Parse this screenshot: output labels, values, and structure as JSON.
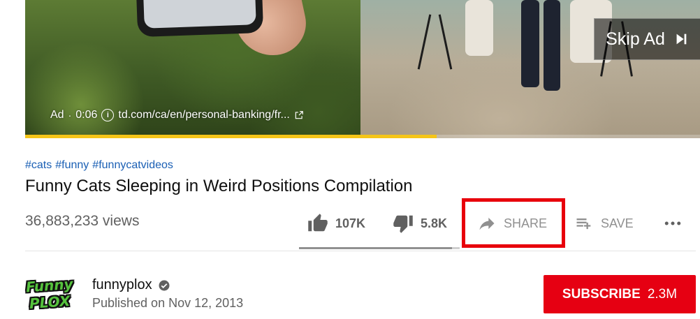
{
  "ad": {
    "label": "Ad",
    "separator": "·",
    "time": "0:06",
    "url": "td.com/ca/en/personal-banking/fr...",
    "skip_label": "Skip Ad",
    "progress": 0.61
  },
  "video": {
    "hashtags": [
      "#cats",
      "#funny",
      "#funnycatvideos"
    ],
    "title": "Funny Cats Sleeping in Weird Positions Compilation",
    "views": "36,883,233 views"
  },
  "actions": {
    "like_count": "107K",
    "dislike_count": "5.8K",
    "share_label": "SHARE",
    "save_label": "SAVE",
    "like_ratio": 0.95
  },
  "channel": {
    "avatar_line1": "Funny",
    "avatar_line2": "PLOX",
    "name": "funnyplox",
    "published": "Published on Nov 12, 2013",
    "subscribe_label": "SUBSCRIBE",
    "subscriber_count": "2.3M"
  },
  "colors": {
    "highlight": "#e8000b",
    "subscribe": "#e60012",
    "link": "#1a5fb4",
    "ad_progress": "#f5c518"
  },
  "icons": {
    "like": "thumbs-up-icon",
    "dislike": "thumbs-down-icon",
    "share": "share-arrow-icon",
    "save": "playlist-add-icon",
    "more": "more-horizontal-icon",
    "verified": "verified-check-icon",
    "skip": "skip-next-icon",
    "info": "info-icon",
    "external": "external-link-icon"
  }
}
